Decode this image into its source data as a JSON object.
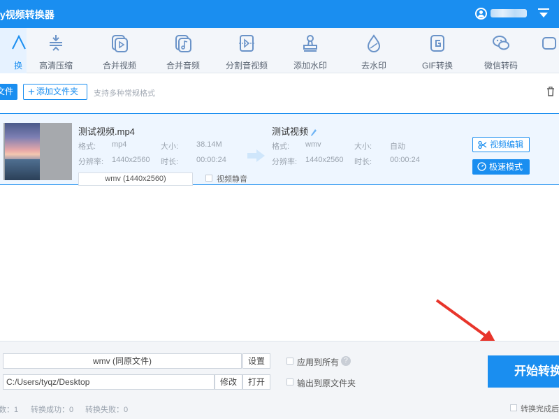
{
  "window": {
    "title": "y视频转换器"
  },
  "toolbar": {
    "tabs": [
      {
        "label": "换",
        "icon": "convert-icon",
        "active": true
      },
      {
        "label": "高清压缩",
        "icon": "compress-icon"
      },
      {
        "label": "合并视频",
        "icon": "merge-video-icon"
      },
      {
        "label": "合并音频",
        "icon": "merge-audio-icon"
      },
      {
        "label": "分割音视频",
        "icon": "split-icon"
      },
      {
        "label": "添加水印",
        "icon": "stamp-icon"
      },
      {
        "label": "去水印",
        "icon": "drop-icon"
      },
      {
        "label": "GIF转换",
        "icon": "gif-icon"
      },
      {
        "label": "微信转码",
        "icon": "wechat-icon"
      },
      {
        "label": "",
        "icon": "more-icon"
      }
    ]
  },
  "actions": {
    "add_file": "文件",
    "add_folder": "添加文件夹",
    "hint": "支持多种常规格式"
  },
  "file": {
    "source": {
      "name": "测试视频.mp4",
      "format_label": "格式:",
      "format": "mp4",
      "size_label": "大小:",
      "size": "38.14M",
      "resolution_label": "分辨率:",
      "resolution": "1440x2560",
      "duration_label": "时长:",
      "duration": "00:00:24",
      "format_select": "wmv (1440x2560)",
      "mute_label": "视频静音"
    },
    "target": {
      "name": "测试视频",
      "format_label": "格式:",
      "format": "wmv",
      "size_label": "大小:",
      "size": "自动",
      "resolution_label": "分辨率:",
      "resolution": "1440x2560",
      "duration_label": "时长:",
      "duration": "00:00:24"
    },
    "edit_button": "视频编辑",
    "speed_button": "极速模式"
  },
  "output": {
    "format": "wmv (同原文件)",
    "settings_button": "设置",
    "path": "C:/Users/tyqz/Desktop",
    "modify_button": "修改",
    "open_button": "打开",
    "apply_all": "应用到所有",
    "output_to_source": "输出到原文件夹",
    "start_button": "开始转换",
    "after_done": "转换完成后"
  },
  "status": {
    "total": "数：1",
    "success": "转换成功：0",
    "failed": "转换失败：0"
  },
  "colors": {
    "accent": "#1a8ef0",
    "annotation_arrow": "#e8352b"
  }
}
